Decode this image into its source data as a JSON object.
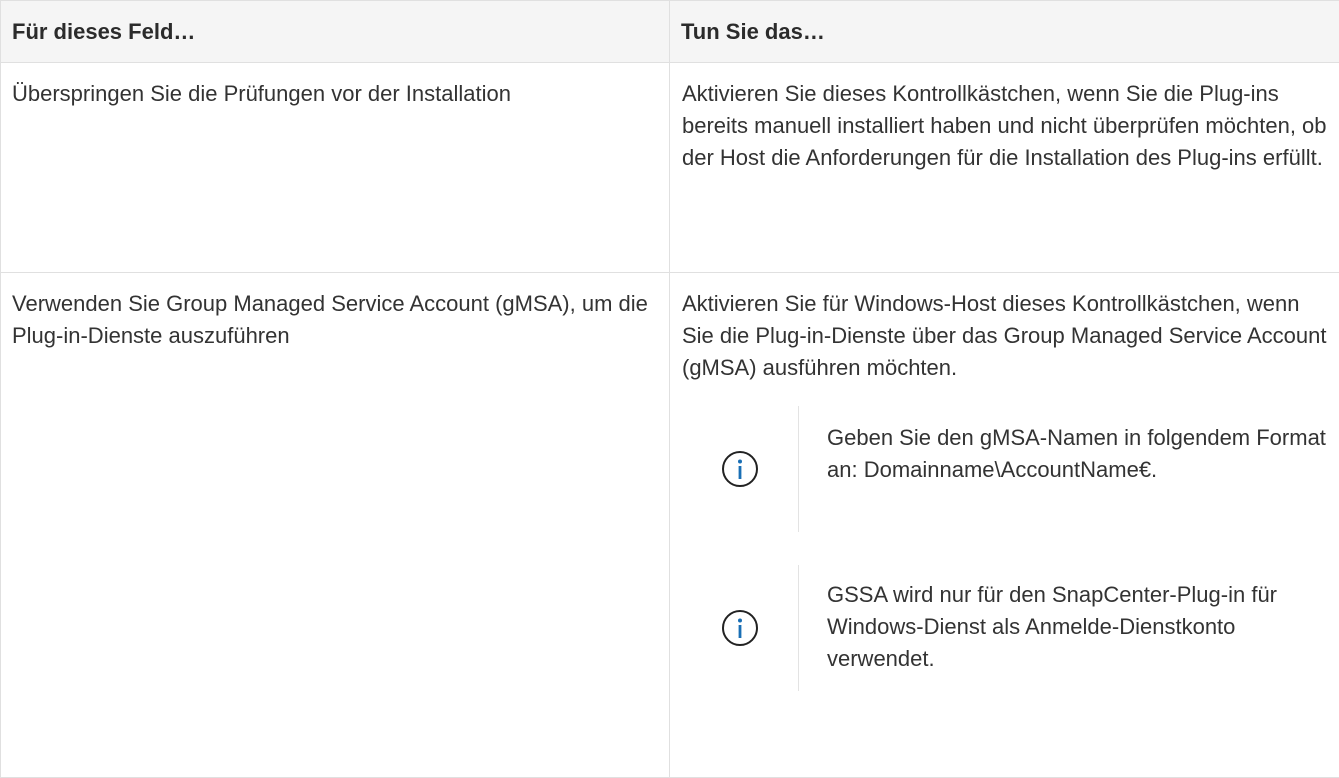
{
  "table": {
    "headers": [
      "Für dieses Feld…",
      "Tun Sie das…"
    ],
    "rows": [
      {
        "field": "Überspringen Sie die Prüfungen vor der Installation",
        "action": "Aktivieren Sie dieses Kontrollkästchen, wenn Sie die Plug-ins bereits manuell installiert haben und nicht überprüfen möchten, ob der Host die Anforderungen für die Installation des Plug-ins erfüllt."
      },
      {
        "field": "Verwenden Sie Group Managed Service Account (gMSA), um die Plug-in-Dienste auszuführen",
        "action": "Aktivieren Sie für Windows-Host dieses Kontrollkästchen, wenn Sie die Plug-in-Dienste über das Group Managed Service Account (gMSA) ausführen möchten.",
        "notes": [
          {
            "icon": "info-icon",
            "text": "Geben Sie den gMSA-Namen in folgendem Format an: Domainname\\AccountName€."
          },
          {
            "icon": "info-icon",
            "text": "GSSA wird nur für den SnapCenter-Plug-in für Windows-Dienst als Anmelde-Dienstkonto verwendet."
          }
        ]
      }
    ]
  },
  "colors": {
    "icon": "#1a6fb5",
    "header_bg": "#f5f5f5",
    "border": "#e0e0e0",
    "text": "#333333"
  }
}
